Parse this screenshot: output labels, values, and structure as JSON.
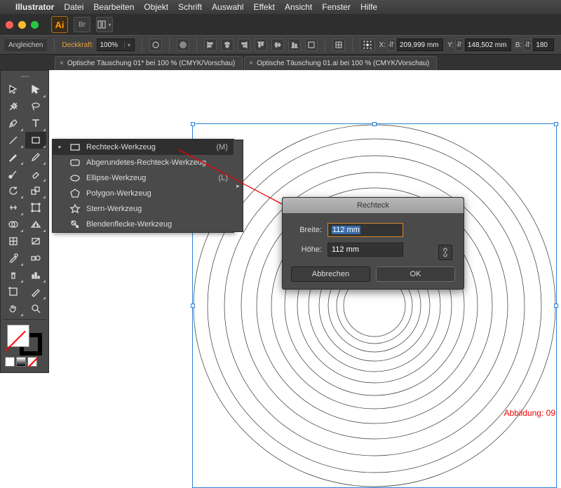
{
  "macmenu": {
    "app": "Illustrator",
    "items": [
      "Datei",
      "Bearbeiten",
      "Objekt",
      "Schrift",
      "Auswahl",
      "Effekt",
      "Ansicht",
      "Fenster",
      "Hilfe"
    ]
  },
  "header": {
    "br": "Br"
  },
  "control": {
    "align": "Angleichen",
    "opacity_label": "Deckkraft:",
    "opacity_value": "100%",
    "x_label": "X:",
    "y_label": "Y:",
    "x_value": "209,999 mm",
    "y_value": "148,502 mm",
    "b_label": "B:",
    "b_value": "180"
  },
  "tabs": [
    {
      "label": "Optische Täuschung 01* bei 100 % (CMYK/Vorschau)"
    },
    {
      "label": "Optische Täuschung 01.ai bei 100 % (CMYK/Vorschau)"
    }
  ],
  "flyout": {
    "items": [
      {
        "label": "Rechteck-Werkzeug",
        "shortcut": "(M)",
        "selected": true,
        "icon": "rect"
      },
      {
        "label": "Abgerundetes-Rechteck-Werkzeug",
        "shortcut": "",
        "icon": "rrect"
      },
      {
        "label": "Ellipse-Werkzeug",
        "shortcut": "(L)",
        "icon": "ellipse"
      },
      {
        "label": "Polygon-Werkzeug",
        "shortcut": "",
        "icon": "poly"
      },
      {
        "label": "Stern-Werkzeug",
        "shortcut": "",
        "icon": "star"
      },
      {
        "label": "Blendenflecke-Werkzeug",
        "shortcut": "",
        "icon": "flare"
      }
    ]
  },
  "dialog": {
    "title": "Rechteck",
    "width_label": "Breite:",
    "width_value": "112 mm",
    "height_label": "Höhe:",
    "height_value": "112 mm",
    "cancel": "Abbrechen",
    "ok": "OK"
  },
  "caption": "Abbildung: 09"
}
